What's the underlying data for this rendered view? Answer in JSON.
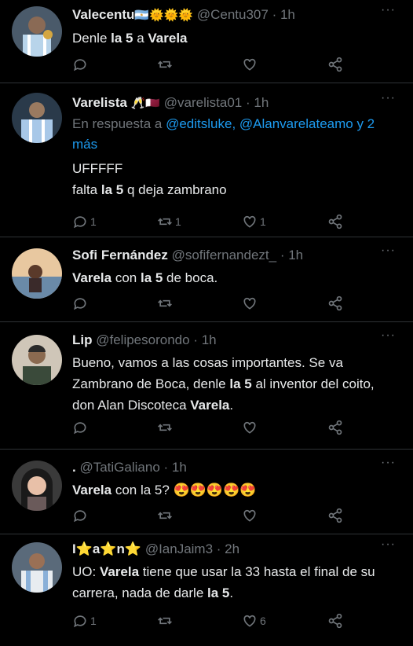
{
  "tweets": [
    {
      "name": "Valecentu",
      "name_emojis": "🇦🇷🌞🌞🌞",
      "handle": "@Centu307",
      "time": "· 1h",
      "text_parts": [
        "Denle ",
        "la 5",
        " a ",
        "Varela"
      ],
      "replies": "",
      "retweets": "",
      "likes": ""
    },
    {
      "name": "Varelista",
      "name_emojis": "🥂🇶🇦",
      "handle": "@varelista01",
      "time": "· 1h",
      "reply_prefix": "En respuesta a",
      "reply_mentions": "@editsluke, @Alanvarelateamo y 2 más",
      "line1": "UFFFFF",
      "line2_parts": [
        "falta ",
        "la 5",
        " q deja zambrano"
      ],
      "replies": "1",
      "retweets": "1",
      "likes": "1"
    },
    {
      "name": "Sofi Fernández",
      "handle": "@sofifernandezt_",
      "time": "· 1h",
      "text_parts": [
        "Varela",
        " con ",
        "la 5",
        " de boca."
      ],
      "replies": "",
      "retweets": "",
      "likes": ""
    },
    {
      "name": "Lip",
      "handle": "@felipesorondo",
      "time": "· 1h",
      "text_parts": [
        "Bueno, vamos a las cosas importantes. Se va Zambrano de Boca, denle ",
        "la 5",
        " al inventor del coito, don Alan Discoteca ",
        "Varela",
        "."
      ],
      "replies": "",
      "retweets": "",
      "likes": ""
    },
    {
      "name": ".",
      "handle": "@TatiGaliano",
      "time": "· 1h",
      "text_parts": [
        "Varela",
        " con la 5? ",
        "😍😍😍😍😍"
      ],
      "replies": "",
      "retweets": "",
      "likes": ""
    },
    {
      "name": "I⭐a⭐n⭐",
      "handle": "@IanJaim3",
      "time": "· 2h",
      "text_parts": [
        "UO: ",
        "Varela",
        " tiene que usar la 33 hasta el final de su carrera, nada de darle ",
        "la 5",
        "."
      ],
      "replies": "1",
      "retweets": "",
      "likes": "6"
    }
  ],
  "colors": {
    "background": "#000000",
    "text": "#e7e9ea",
    "muted": "#71767b",
    "link": "#1d9bf0",
    "divider": "#2f3336"
  },
  "icons": [
    "more-icon",
    "reply-icon",
    "retweet-icon",
    "like-icon",
    "share-icon"
  ]
}
